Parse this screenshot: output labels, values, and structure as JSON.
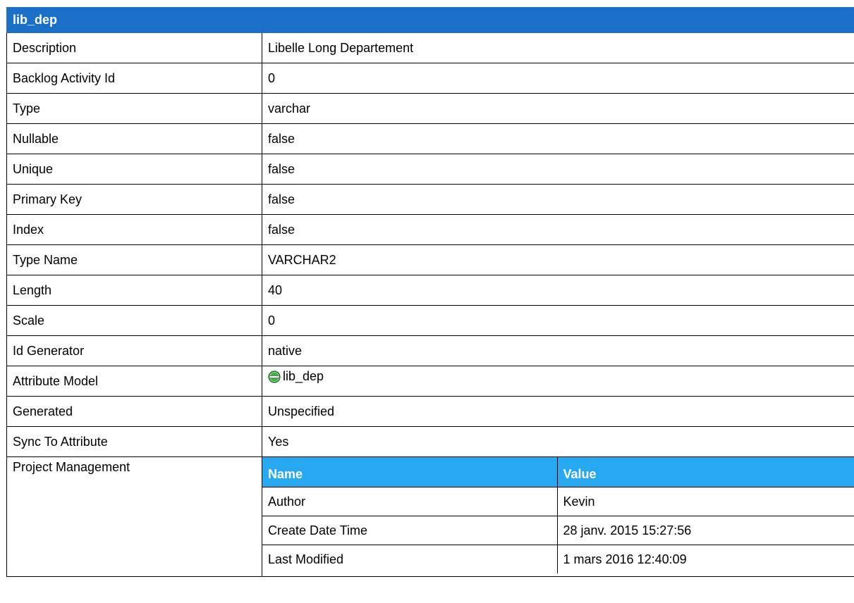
{
  "title": "lib_dep",
  "rows": [
    {
      "label": "Description",
      "value": "Libelle Long Departement"
    },
    {
      "label": "Backlog Activity Id",
      "value": "0"
    },
    {
      "label": "Type",
      "value": "varchar"
    },
    {
      "label": "Nullable",
      "value": "false"
    },
    {
      "label": "Unique",
      "value": "false"
    },
    {
      "label": "Primary Key",
      "value": "false"
    },
    {
      "label": "Index",
      "value": "false"
    },
    {
      "label": "Type Name",
      "value": "VARCHAR2"
    },
    {
      "label": "Length",
      "value": "40"
    },
    {
      "label": "Scale",
      "value": "0"
    },
    {
      "label": "Id Generator",
      "value": "native"
    },
    {
      "label": "Attribute Model",
      "value": "lib_dep",
      "icon": "attribute-icon"
    },
    {
      "label": "Generated",
      "value": "Unspecified"
    },
    {
      "label": "Sync To Attribute",
      "value": "Yes"
    }
  ],
  "project_management": {
    "label": "Project Management",
    "headers": {
      "name": "Name",
      "value": "Value"
    },
    "rows": [
      {
        "name": "Author",
        "value": "Kevin"
      },
      {
        "name": "Create Date Time",
        "value": "28 janv. 2015 15:27:56"
      },
      {
        "name": "Last Modified",
        "value": "1 mars 2016 12:40:09"
      }
    ]
  },
  "colors": {
    "header": "#1a6fc6",
    "subheader": "#26a9f0",
    "icon_green": "#3cb043"
  }
}
